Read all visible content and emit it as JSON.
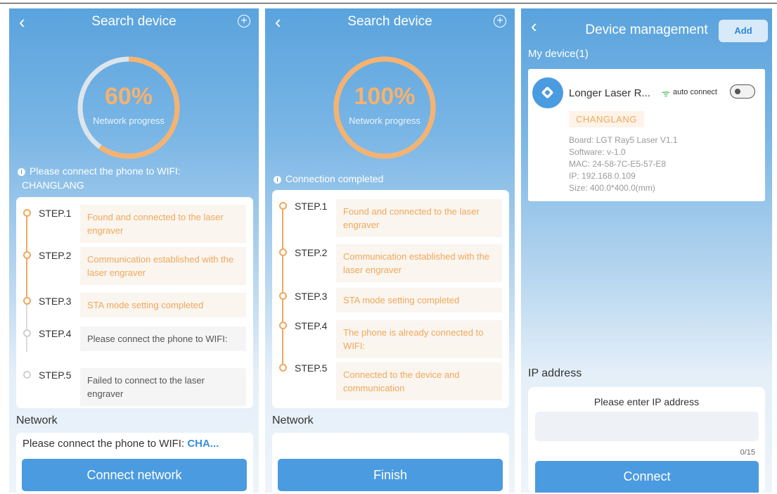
{
  "colors": {
    "accent_blue": "#4b9be0",
    "progress_orange": "#f6b26e",
    "step_text_orange": "#f0a85c",
    "wifi_green": "#37b24d"
  },
  "icons": {
    "back": "chevron-left-icon",
    "plus": "plus-circle-icon",
    "info": "info-icon",
    "wifi": "wifi-icon",
    "device": "cube-icon"
  },
  "p1": {
    "title": "Search device",
    "back": "‹",
    "plus": "+",
    "progress_value": 0.6,
    "progress_pct": "60%",
    "progress_label": "Network progress",
    "info_text": "Please connect the phone to WIFI:",
    "info_ssid": "CHANGLANG",
    "steps": [
      {
        "label": "STEP.1",
        "text": "Found and connected to the laser engraver",
        "state": "done"
      },
      {
        "label": "STEP.2",
        "text": "Communication established with the laser engraver",
        "state": "done"
      },
      {
        "label": "STEP.3",
        "text": "STA mode setting completed",
        "state": "done"
      },
      {
        "label": "STEP.4",
        "text": "Please connect the phone to WIFI:",
        "state": "pending"
      },
      {
        "label": "STEP.5",
        "text": "Failed to connect to the laser engraver",
        "state": "pending"
      }
    ],
    "network_title": "Network",
    "network_text": "Please connect the phone to WIFI: ",
    "network_ssid": "CHA...",
    "button": "Connect network"
  },
  "p2": {
    "title": "Search device",
    "back": "‹",
    "plus": "+",
    "progress_value": 1.0,
    "progress_pct": "100%",
    "progress_label": "Network progress",
    "info_text": "Connection completed",
    "steps": [
      {
        "label": "STEP.1",
        "text": "Found and connected to the laser engraver",
        "state": "done"
      },
      {
        "label": "STEP.2",
        "text": "Communication established with the laser engraver",
        "state": "done"
      },
      {
        "label": "STEP.3",
        "text": "STA mode setting completed",
        "state": "done"
      },
      {
        "label": "STEP.4",
        "text": "The phone is already connected to WIFI:",
        "state": "done"
      },
      {
        "label": "STEP.5",
        "text": "Connected to the device and communication",
        "state": "done"
      }
    ],
    "network_title": "Network",
    "button": "Finish"
  },
  "p3": {
    "title": "Device management",
    "back": "‹",
    "add": "Add",
    "my_device": "My device(1)",
    "device": {
      "name": "Longer Laser R...",
      "wifi_glyph": "ᯤ",
      "auto_connect": "auto connect",
      "auto_connect_on": false,
      "tag": "CHANGLANG",
      "board": "Board:  LGT Ray5 Laser V1.1",
      "software": "Software:  v-1.0",
      "mac": "MAC:  24-58-7C-E5-57-E8",
      "ip": "IP:  192.168.0.109",
      "size": "Size:  400.0*400.0(mm)"
    },
    "ip_title": "IP address",
    "ip_placeholder": "Please enter IP address",
    "ip_value": "",
    "counter": "0/15",
    "button": "Connect"
  }
}
